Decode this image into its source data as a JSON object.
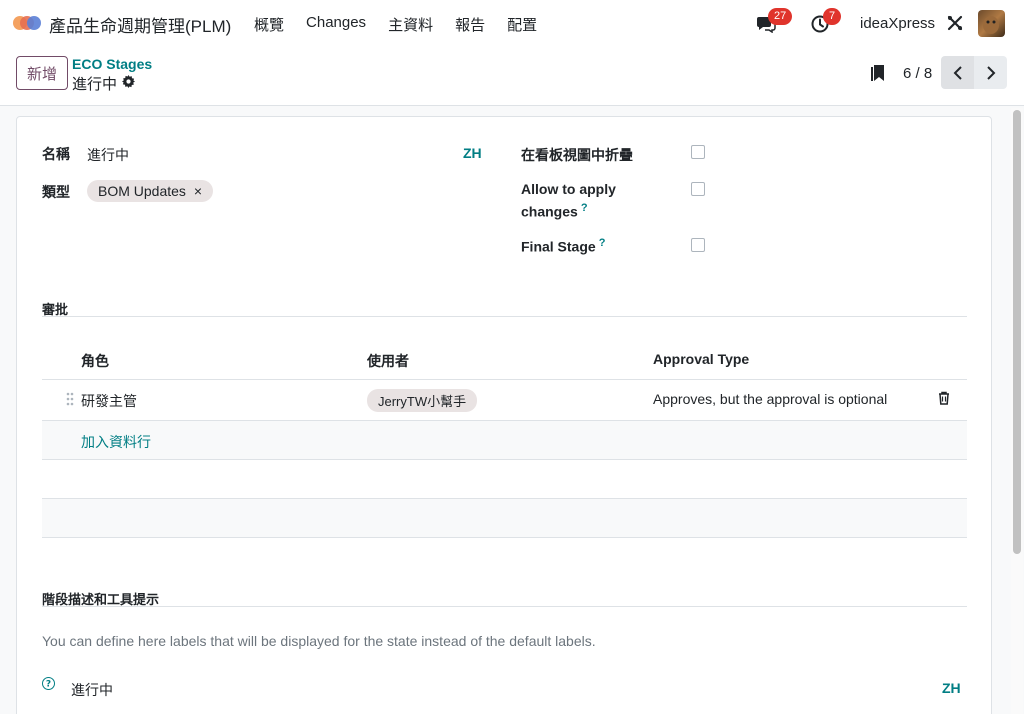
{
  "navbar": {
    "app_title": "產品生命週期管理(PLM)",
    "menu": [
      "概覽",
      "Changes",
      "主資料",
      "報告",
      "配置"
    ],
    "messages_count": "27",
    "activities_count": "7",
    "company": "ideaXpress"
  },
  "control_panel": {
    "new_button": "新增",
    "breadcrumb_parent": "ECO Stages",
    "breadcrumb_current": "進行中",
    "pager_value": "6 / 8"
  },
  "form": {
    "name_label": "名稱",
    "name_value": "進行中",
    "name_lang": "ZH",
    "type_label": "類型",
    "type_tag": "BOM Updates",
    "fold_label": "在看板視圖中折疊",
    "allow_apply_label_line1": "Allow to apply",
    "allow_apply_label_line2": "changes",
    "final_stage_label": "Final Stage",
    "help_mark": "?",
    "fold_checked": false,
    "allow_apply_checked": false,
    "final_stage_checked": false
  },
  "approvals": {
    "section_title": "審批",
    "columns": [
      "角色",
      "使用者",
      "Approval Type"
    ],
    "rows": [
      {
        "role": "研發主管",
        "user": "JerryTW小幫手",
        "approval_type": "Approves, but the approval is optional"
      }
    ],
    "add_line": "加入資料行"
  },
  "stage_desc": {
    "section_title": "階段描述和工具提示",
    "help_text": "You can define here labels that will be displayed for the state instead of the default labels.",
    "state_label": "進行中",
    "state_lang": "ZH"
  },
  "colors": {
    "accent": "#017e84",
    "brand": "#714b67",
    "badge": "#e0342c"
  }
}
